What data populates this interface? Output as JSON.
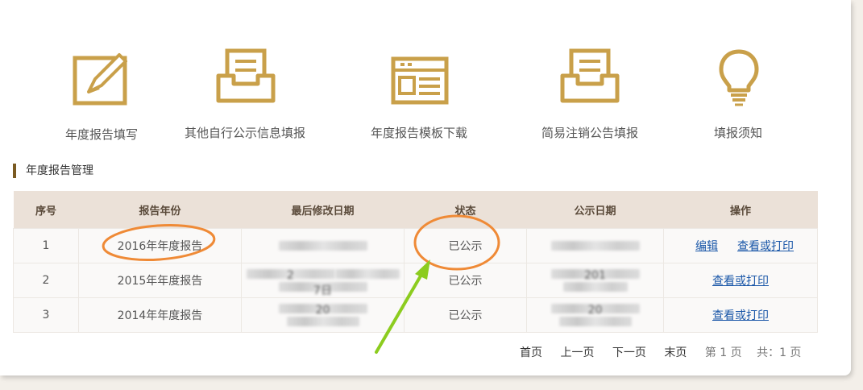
{
  "shortcuts": [
    {
      "label": "年度报告填写",
      "icon": "edit-form-icon"
    },
    {
      "label": "其他自行公示信息填报",
      "icon": "document-tray-icon"
    },
    {
      "label": "年度报告模板下载",
      "icon": "template-icon"
    },
    {
      "label": "简易注销公告填报",
      "icon": "document-tray-icon"
    },
    {
      "label": "填报须知",
      "icon": "lightbulb-icon"
    }
  ],
  "section_title": "年度报告管理",
  "table": {
    "headers": [
      "序号",
      "报告年份",
      "最后修改日期",
      "状态",
      "公示日期",
      "操作"
    ],
    "rows": [
      {
        "idx": "1",
        "year": "2016年年度报告",
        "modified_prefix": "",
        "modified_suffix": "",
        "status": "已公示",
        "public_prefix": "",
        "public_suffix": "",
        "action_edit": "编辑",
        "action_view": "查看或打印"
      },
      {
        "idx": "2",
        "year": "2015年年度报告",
        "modified_prefix": "2",
        "modified_suffix": "7日",
        "status": "已公示",
        "public_prefix": "201",
        "public_suffix": "",
        "action_edit": "",
        "action_view": "查看或打印"
      },
      {
        "idx": "3",
        "year": "2014年年度报告",
        "modified_prefix": "20",
        "modified_suffix": "",
        "status": "已公示",
        "public_prefix": "20",
        "public_suffix": "",
        "action_edit": "",
        "action_view": "查看或打印"
      }
    ]
  },
  "pager": {
    "first": "首页",
    "prev": "上一页",
    "next": "下一页",
    "last": "末页",
    "current": "第 1 页",
    "total": "共：1 页"
  },
  "colors": {
    "accent": "#c9a04a",
    "annotation_orange": "#ef8a36",
    "annotation_green": "#8ccc1f"
  }
}
